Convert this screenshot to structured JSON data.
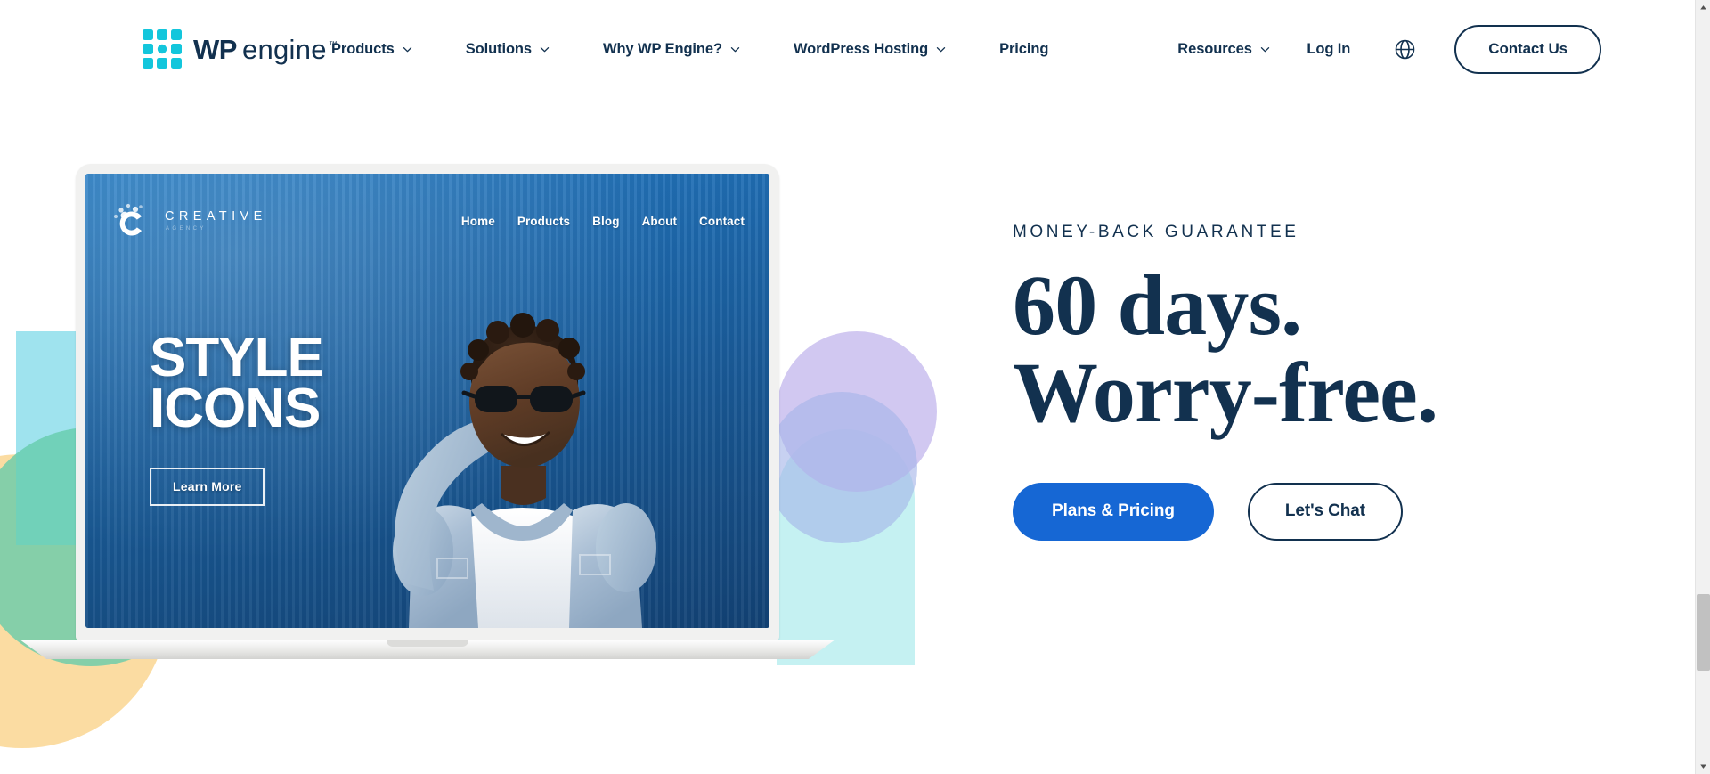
{
  "header": {
    "logo": {
      "mark_icon": "wp-engine-logo-mark",
      "wp_text": "WP",
      "engine_text": "engine",
      "trademark": "™",
      "mark_color": "#13c6dc",
      "word_color": "#12314f"
    },
    "nav_items": [
      {
        "label": "Products",
        "has_dropdown": true
      },
      {
        "label": "Solutions",
        "has_dropdown": true
      },
      {
        "label": "Why WP Engine?",
        "has_dropdown": true
      },
      {
        "label": "WordPress Hosting",
        "has_dropdown": true
      },
      {
        "label": "Pricing",
        "has_dropdown": false
      }
    ],
    "resources": {
      "label": "Resources",
      "has_dropdown": true
    },
    "login_label": "Log In",
    "language_icon": "globe-icon",
    "contact_label": "Contact Us"
  },
  "hero": {
    "eyebrow": "MONEY-BACK GUARANTEE",
    "title_line1": "60 days.",
    "title_line2": "Worry-free.",
    "primary_cta": "Plans & Pricing",
    "secondary_cta": "Let's Chat",
    "title_color": "#12314f",
    "primary_cta_color": "#1667d4"
  },
  "laptop_mockup": {
    "demo_site": {
      "logo_title": "CREATIVE",
      "logo_subtitle": "AGENCY",
      "logo_icon": "creative-agency-logo-mark",
      "nav": [
        "Home",
        "Products",
        "Blog",
        "About",
        "Contact"
      ],
      "headline_line1": "STYLE",
      "headline_line2": "ICONS",
      "cta_label": "Learn More",
      "background_color": "#1e6cb3"
    }
  },
  "decorations": [
    {
      "name": "cyan-rectangle",
      "color": "#9fe3ee"
    },
    {
      "name": "green-circle",
      "color": "#64ccaa"
    },
    {
      "name": "yellow-circle",
      "color": "#face7e"
    },
    {
      "name": "purple-circle",
      "color": "#c6baee"
    },
    {
      "name": "blue-circle",
      "color": "#a5b4e8"
    },
    {
      "name": "cyan-arch",
      "color": "#c5f1f2"
    }
  ],
  "scrollbar": {
    "up_arrow": "▲",
    "down_arrow": "▼",
    "thumb_position_percent": 77
  }
}
